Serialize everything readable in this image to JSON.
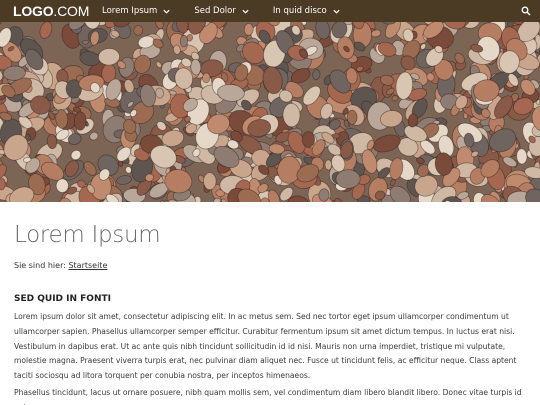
{
  "header": {
    "logo_part1": "LOGO",
    "logo_part2": ".COM",
    "nav": [
      {
        "label": "Lorem Ipsum"
      },
      {
        "label": "Sed Dolor"
      },
      {
        "label": "In quid disco"
      }
    ],
    "bar_color": "#4b3a24",
    "search_icon": "search-icon"
  },
  "hero": {
    "description_icon": "pebbles-photo"
  },
  "main": {
    "title": "Lorem Ipsum",
    "breadcrumb_prefix": "Sie sind hier:",
    "breadcrumb_link": "Startseite",
    "section_heading": "SED QUID IN FONTI",
    "paragraph1": "Lorem ipsum dolor sit amet, consectetur adipiscing elit. In ac metus sem. Sed nec tortor eget ipsum ullamcorper condimentum ut ullamcorper sapien. Phasellus ullamcorper semper efficitur. Curabitur fermentum ipsum sit amet dictum tempus. In luctus erat nisi. Vestibulum in dapibus erat. Ut ac ante quis nibh tincidunt sollicitudin id id nisi. Mauris non urna imperdiet, tristique mi vulputate, molestie magna. Praesent viverra turpis erat, nec pulvinar diam aliquet nec. Fusce ut tincidunt felis, ac efficitur neque. Class aptent taciti sociosqu ad litora torquent per conubia nostra, per inceptos himenaeos.",
    "paragraph2": "Phasellus tincidunt, lacus ut ornare posuere, nibh quam mollis sem, vel condimentum diam libero blandit libero. Donec vitae turpis id enim"
  }
}
